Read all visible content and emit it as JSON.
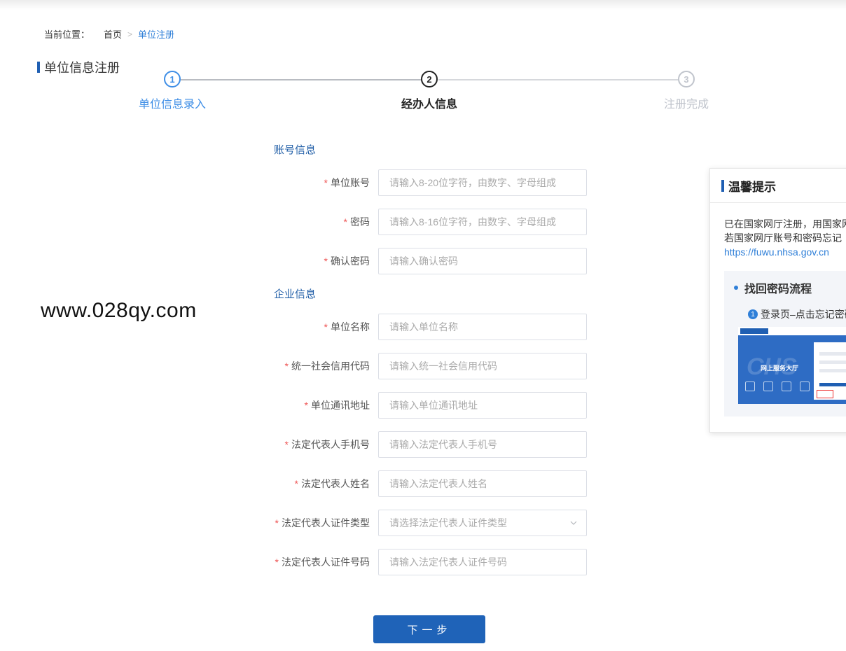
{
  "breadcrumb": {
    "prefix": "当前位置：",
    "home": "首页",
    "separator": ">",
    "current": "单位注册"
  },
  "page_title": "单位信息注册",
  "steps": [
    {
      "num": "1",
      "label": "单位信息录入",
      "state": "done"
    },
    {
      "num": "2",
      "label": "经办人信息",
      "state": "active"
    },
    {
      "num": "3",
      "label": "注册完成",
      "state": "pending"
    }
  ],
  "sections": {
    "account": "账号信息",
    "company": "企业信息"
  },
  "fields": {
    "unit_account": {
      "label": "单位账号",
      "required": "*",
      "placeholder": "请输入8-20位字符，由数字、字母组成"
    },
    "password": {
      "label": "密码",
      "required": "*",
      "placeholder": "请输入8-16位字符，由数字、字母组成"
    },
    "confirm_password": {
      "label": "确认密码",
      "required": "*",
      "placeholder": "请输入确认密码"
    },
    "unit_name": {
      "label": "单位名称",
      "required": "*",
      "placeholder": "请输入单位名称"
    },
    "credit_code": {
      "label": "统一社会信用代码",
      "required": "*",
      "placeholder": "请输入统一社会信用代码"
    },
    "address": {
      "label": "单位通讯地址",
      "required": "*",
      "placeholder": "请输入单位通讯地址"
    },
    "legal_phone": {
      "label": "法定代表人手机号",
      "required": "*",
      "placeholder": "请输入法定代表人手机号"
    },
    "legal_name": {
      "label": "法定代表人姓名",
      "required": "*",
      "placeholder": "请输入法定代表人姓名"
    },
    "legal_id_type": {
      "label": "法定代表人证件类型",
      "required": "*",
      "placeholder": "请选择法定代表人证件类型"
    },
    "legal_id_no": {
      "label": "法定代表人证件号码",
      "required": "*",
      "placeholder": "请输入法定代表人证件号码"
    }
  },
  "watermark": "www.028qy.com",
  "next_button": "下一步",
  "tips": {
    "title": "温馨提示",
    "line1": "已在国家网厅注册，用国家网",
    "line2": "若国家网厅账号和密码忘记",
    "link": "https://fuwu.nhsa.gov.cn",
    "flow_title": "找回密码流程",
    "step1_num": "1",
    "step1_text": "登录页–点击忘记密码",
    "shot_title": "网上服务大厅"
  },
  "colors": {
    "primary": "#1f63b8",
    "link": "#2f7fd8",
    "required": "#e55555",
    "pending": "#c0c4cc"
  }
}
